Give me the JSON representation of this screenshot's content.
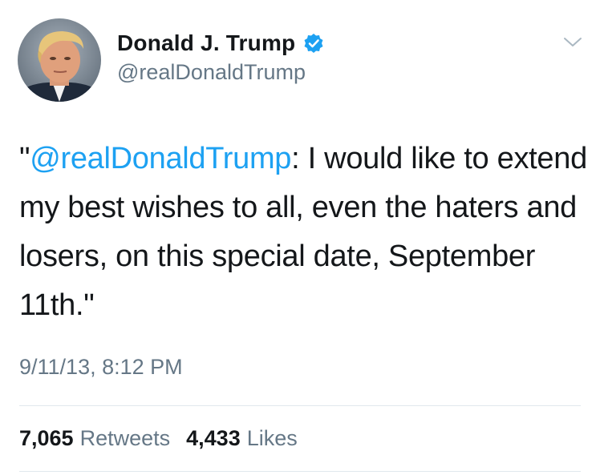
{
  "author": {
    "display_name": "Donald J. Trump",
    "handle": "@realDonaldTrump",
    "verified_icon": "verified-badge-icon",
    "avatar_icon": "profile-photo"
  },
  "tweet": {
    "quote_open": "\"",
    "mention": "@realDonaldTrump",
    "body": ": I would like to extend my best wishes to all, even the haters and losers, on this special date, September 11th.\"",
    "timestamp": "9/11/13, 8:12 PM"
  },
  "stats": {
    "retweets_count": "7,065",
    "retweets_label": "Retweets",
    "likes_count": "4,433",
    "likes_label": "Likes"
  },
  "colors": {
    "accent": "#1da1f2",
    "text": "#14171a",
    "secondary": "#657786",
    "divider": "#e1e8ed"
  }
}
